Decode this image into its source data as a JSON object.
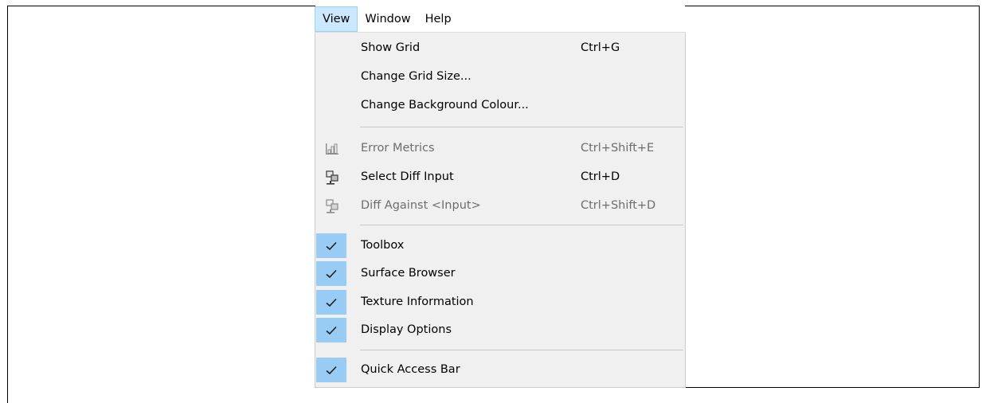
{
  "menubar": {
    "items": [
      {
        "label": "View",
        "active": true
      },
      {
        "label": "Window",
        "active": false
      },
      {
        "label": "Help",
        "active": false
      }
    ]
  },
  "view_menu": {
    "items": [
      {
        "label": "Show Grid",
        "shortcut": "Ctrl+G",
        "enabled": true,
        "checked": false,
        "icon": ""
      },
      {
        "label": "Change Grid Size...",
        "shortcut": "",
        "enabled": true,
        "checked": false,
        "icon": ""
      },
      {
        "label": "Change Background Colour...",
        "shortcut": "",
        "enabled": true,
        "checked": false,
        "icon": ""
      },
      {
        "label": "Error Metrics",
        "shortcut": "Ctrl+Shift+E",
        "enabled": false,
        "checked": false,
        "icon": "bar-chart-icon"
      },
      {
        "label": "Select Diff Input",
        "shortcut": "Ctrl+D",
        "enabled": true,
        "checked": false,
        "icon": "diff-select-icon"
      },
      {
        "label": "Diff Against <Input>",
        "shortcut": "Ctrl+Shift+D",
        "enabled": false,
        "checked": false,
        "icon": "diff-against-icon"
      },
      {
        "label": "Toolbox",
        "shortcut": "",
        "enabled": true,
        "checked": true,
        "icon": "checkmark-icon"
      },
      {
        "label": "Surface Browser",
        "shortcut": "",
        "enabled": true,
        "checked": true,
        "icon": "checkmark-icon"
      },
      {
        "label": "Texture Information",
        "shortcut": "",
        "enabled": true,
        "checked": true,
        "icon": "checkmark-icon"
      },
      {
        "label": "Display Options",
        "shortcut": "",
        "enabled": true,
        "checked": true,
        "icon": "checkmark-icon"
      },
      {
        "label": "Quick Access Bar",
        "shortcut": "",
        "enabled": true,
        "checked": true,
        "icon": "checkmark-icon"
      }
    ]
  },
  "colors": {
    "menu_background": "#f0f0f0",
    "active_menu_background": "#cce8ff",
    "check_gutter": "#99ccf5",
    "disabled_text": "#6d6d6d"
  }
}
